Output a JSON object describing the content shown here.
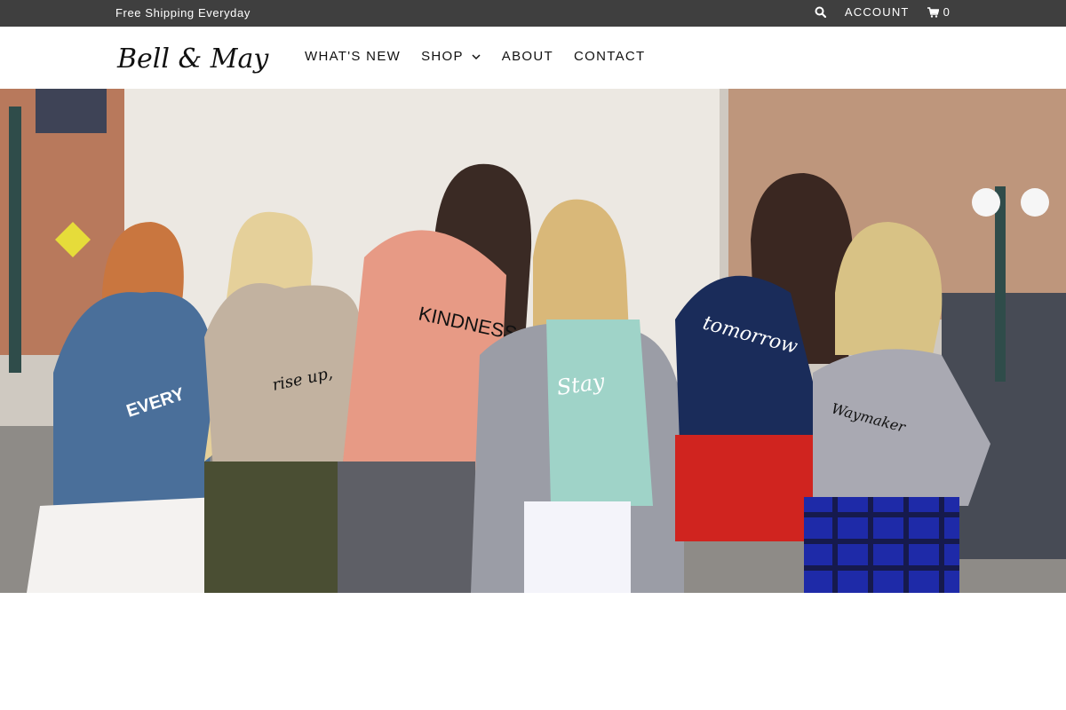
{
  "topbar": {
    "promo_text": "Free Shipping Everyday",
    "account_label": "ACCOUNT",
    "cart_count": "0",
    "icons": {
      "search": "search-icon",
      "cart": "cart-icon"
    }
  },
  "header": {
    "logo_text": "Bell & May",
    "nav": [
      {
        "label": "WHAT'S NEW"
      },
      {
        "label": "SHOP",
        "has_dropdown": true
      },
      {
        "label": "ABOUT"
      },
      {
        "label": "CONTACT"
      }
    ]
  },
  "hero": {
    "shirt_texts": [
      "EVERY MOMENT COUNTS",
      "rise up, warrior",
      "KINDNESS MATTERS",
      "Stay Positive",
      "tomorrow",
      "Waymaker"
    ],
    "colors": {
      "blue_shirt": "#4a6f9a",
      "tan_shirt": "#c2b2a0",
      "coral_shirt": "#e79a85",
      "mint_shirt": "#9fd3c8",
      "navy_shirt": "#1a2c5a",
      "gray_shirt": "#a9a9b2",
      "red_shorts": "#d0241f"
    }
  }
}
